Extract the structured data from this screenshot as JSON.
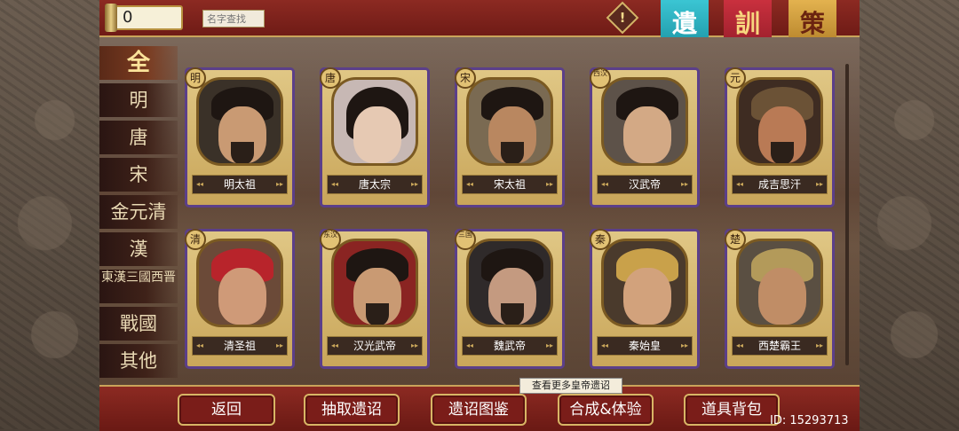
{
  "header": {
    "currency_value": "0",
    "search_placeholder": "名字查找",
    "warning_symbol": "!",
    "banners": [
      {
        "label": "遺",
        "color": "#2ab3c3"
      },
      {
        "label": "訓",
        "color": "#b3243a"
      },
      {
        "label": "策",
        "color": "#d19a3a"
      }
    ]
  },
  "dynasties": [
    {
      "label": "全",
      "active": true
    },
    {
      "label": "明"
    },
    {
      "label": "唐"
    },
    {
      "label": "宋"
    },
    {
      "label": "金元清"
    },
    {
      "label": "漢"
    },
    {
      "label": "東漢三國西晋"
    },
    {
      "label": "戰國"
    },
    {
      "label": "其他"
    }
  ],
  "emperors": [
    {
      "name": "明太祖",
      "dynasty": "明"
    },
    {
      "name": "唐太宗",
      "dynasty": "唐"
    },
    {
      "name": "宋太祖",
      "dynasty": "宋"
    },
    {
      "name": "汉武帝",
      "dynasty": "西汉"
    },
    {
      "name": "成吉思汗",
      "dynasty": "元"
    },
    {
      "name": "清圣祖",
      "dynasty": "清"
    },
    {
      "name": "汉光武帝",
      "dynasty": "东汉"
    },
    {
      "name": "魏武帝",
      "dynasty": "三国"
    },
    {
      "name": "秦始皇",
      "dynasty": "秦"
    },
    {
      "name": "西楚霸王",
      "dynasty": "楚"
    }
  ],
  "footer": {
    "back": "返回",
    "draw": "抽取遗诏",
    "gallery": "遗诏图鉴",
    "synth": "合成&体验",
    "bag": "道具背包",
    "tooltip": "查看更多皇帝遗诏",
    "user_id": "ID: 15293713"
  },
  "colors": {
    "frame_red": "#7a1f1a",
    "gold": "#c9a65a",
    "card_border": "#5b3f89"
  }
}
